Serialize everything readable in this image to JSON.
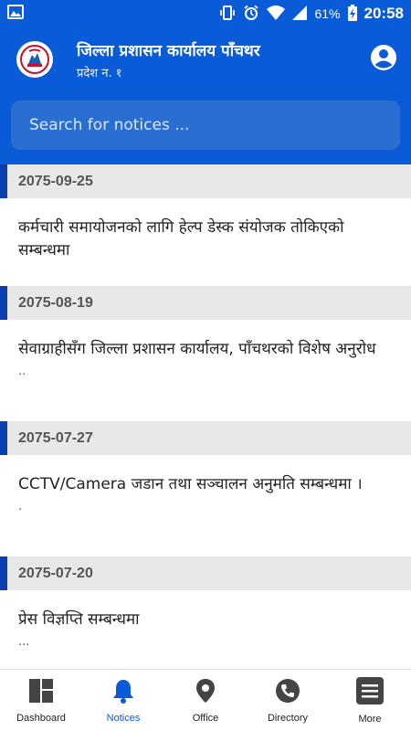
{
  "status_bar": {
    "battery": "61%",
    "time": "20:58"
  },
  "header": {
    "title": "जिल्ला प्रशासन कार्यालय पाँचथर",
    "subtitle": "प्रदेश न. १"
  },
  "search": {
    "placeholder": "Search for notices ..."
  },
  "notices": [
    {
      "date": "2075-09-25",
      "title": "कर्मचारी समायोजनको लागि हेल्प डेस्क संयोजक तोकिएको सम्बन्धमा",
      "snippet": ""
    },
    {
      "date": "2075-08-19",
      "title": "सेवाग्राहीसँग जिल्ला प्रशासन कार्यालय, पाँचथरको विशेष अनुरोध",
      "snippet": ".."
    },
    {
      "date": "2075-07-27",
      "title": "CCTV/Camera जडान तथा सञ्चालन अनुमति सम्बन्धमा ।",
      "snippet": "."
    },
    {
      "date": "2075-07-20",
      "title": "प्रेस विज्ञप्ति सम्बन्धमा",
      "snippet": "..."
    }
  ],
  "bottom_nav": {
    "items": [
      {
        "label": "Dashboard",
        "icon": "dashboard-icon"
      },
      {
        "label": "Notices",
        "icon": "bell-icon"
      },
      {
        "label": "Office",
        "icon": "location-pin-icon"
      },
      {
        "label": "Directory",
        "icon": "phone-icon"
      },
      {
        "label": "More",
        "icon": "menu-icon"
      }
    ],
    "active": "Notices"
  },
  "colors": {
    "primary": "#0a5bd8",
    "date_accent": "#0b3fb0",
    "date_bg": "#e8e8e8"
  }
}
